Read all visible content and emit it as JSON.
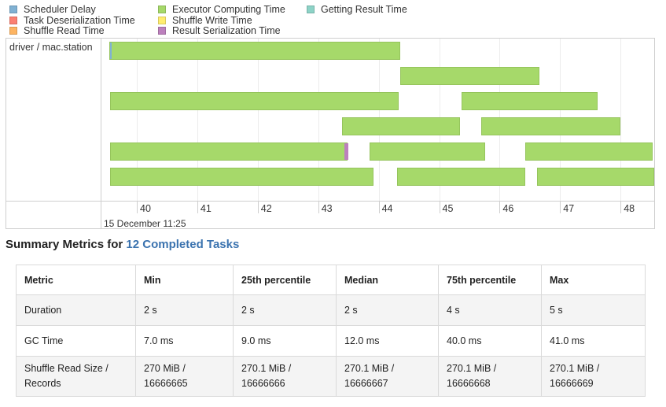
{
  "legend": [
    {
      "label": "Scheduler Delay",
      "color": "#80b1d3"
    },
    {
      "label": "Task Deserialization Time",
      "color": "#fb8072"
    },
    {
      "label": "Shuffle Read Time",
      "color": "#fdb462"
    },
    {
      "label": "Executor Computing Time",
      "color": "#a6d96a"
    },
    {
      "label": "Shuffle Write Time",
      "color": "#ffed6f"
    },
    {
      "label": "Result Serialization Time",
      "color": "#bc80bd"
    },
    {
      "label": "Getting Result Time",
      "color": "#8dd3c7"
    }
  ],
  "timeline": {
    "executor_label": "driver / mac.station",
    "axis_ticks": [
      "40",
      "41",
      "42",
      "43",
      "44",
      "45",
      "46",
      "47",
      "48"
    ],
    "date_label": "15 December 11:25",
    "tasks": [
      {
        "start": 39.54,
        "end": 44.35,
        "row": 0,
        "scheduler_delay_end": 39.57
      },
      {
        "start": 44.35,
        "end": 46.66,
        "row": 1
      },
      {
        "start": 39.56,
        "end": 44.33,
        "row": 2
      },
      {
        "start": 45.37,
        "end": 47.62,
        "row": 2
      },
      {
        "start": 43.39,
        "end": 45.35,
        "row": 3
      },
      {
        "start": 45.7,
        "end": 48.0,
        "row": 3
      },
      {
        "start": 39.56,
        "end": 43.48,
        "row": 4,
        "serialization_start": 43.42
      },
      {
        "start": 43.85,
        "end": 45.76,
        "row": 4
      },
      {
        "start": 46.42,
        "end": 48.53,
        "row": 4
      },
      {
        "start": 39.56,
        "end": 43.91,
        "row": 5
      },
      {
        "start": 44.3,
        "end": 46.42,
        "row": 5
      },
      {
        "start": 46.62,
        "end": 48.58,
        "row": 5
      }
    ]
  },
  "summary": {
    "prefix": "Summary Metrics for ",
    "link": "12 Completed Tasks",
    "headers": [
      "Metric",
      "Min",
      "25th percentile",
      "Median",
      "75th percentile",
      "Max"
    ],
    "rows": [
      {
        "metric": "Duration",
        "values": [
          "2 s",
          "2 s",
          "2 s",
          "4 s",
          "5 s"
        ]
      },
      {
        "metric": "GC Time",
        "values": [
          "7.0 ms",
          "9.0 ms",
          "12.0 ms",
          "40.0 ms",
          "41.0 ms"
        ]
      },
      {
        "metric": [
          "Shuffle Read Size /",
          "Records"
        ],
        "values": [
          [
            "270 MiB /",
            "16666665"
          ],
          [
            "270.1 MiB /",
            "16666666"
          ],
          [
            "270.1 MiB /",
            "16666667"
          ],
          [
            "270.1 MiB /",
            "16666668"
          ],
          [
            "270.1 MiB /",
            "16666669"
          ]
        ]
      }
    ]
  }
}
